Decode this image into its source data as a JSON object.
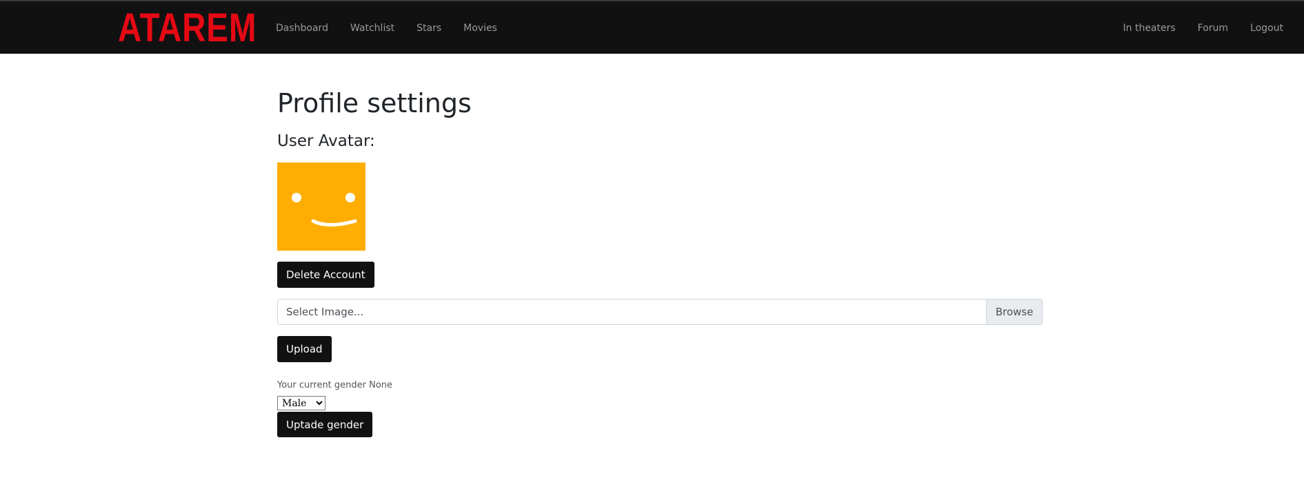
{
  "brand": {
    "name": "ATAREM",
    "color": "#e50914"
  },
  "nav": {
    "left": [
      "Dashboard",
      "Watchlist",
      "Stars",
      "Movies"
    ],
    "right": [
      "In theaters",
      "Forum",
      "Logout"
    ]
  },
  "page": {
    "title": "Profile settings",
    "avatar_heading": "User Avatar:"
  },
  "avatar": {
    "icon": "smiley-face-icon",
    "background": "#ffad00"
  },
  "actions": {
    "delete_label": "Delete Account",
    "upload_label": "Upload",
    "update_gender_label": "Uptade gender"
  },
  "file_input": {
    "placeholder": "Select Image...",
    "browse_label": "Browse"
  },
  "gender": {
    "current_text": "Your current gender None",
    "selected": "Male"
  }
}
